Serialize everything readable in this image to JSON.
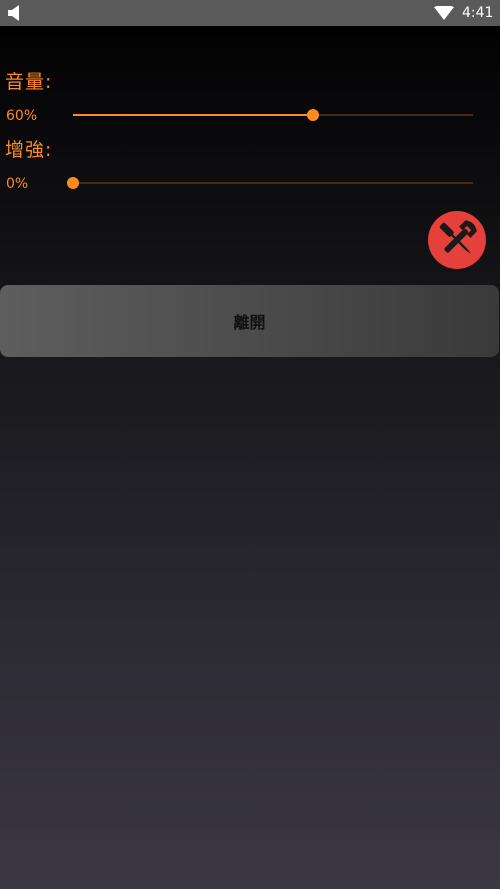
{
  "status_bar": {
    "time": "4:41",
    "icons": [
      "speaker-icon",
      "wifi-icon"
    ]
  },
  "volume": {
    "label": "音量:",
    "value_text": "60%",
    "level": 0.6
  },
  "boost": {
    "label": "增強:",
    "value_text": "0%",
    "level": 0.0
  },
  "tools_button": {
    "icon": "wrench-screwdriver-icon",
    "color": "#e5403a"
  },
  "exit_button": {
    "label": "離開"
  },
  "colors": {
    "accent": "#ff8a1f",
    "track": "#4a2a10",
    "status_bar": "#5a5a5a"
  }
}
